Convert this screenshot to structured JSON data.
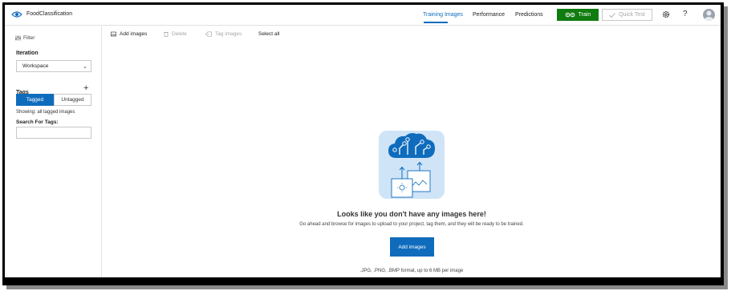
{
  "header": {
    "project_name": "FoodClassification",
    "tabs": [
      {
        "label": "Training Images",
        "active": true
      },
      {
        "label": "Performance",
        "active": false
      },
      {
        "label": "Predictions",
        "active": false
      }
    ],
    "train_label": "Train",
    "quick_test_label": "Quick Test",
    "help_label": "?",
    "accent_color": "#0f6cbd",
    "train_color": "#107c10",
    "icons": [
      "eye-logo-icon",
      "gear-icon",
      "help-icon",
      "avatar"
    ]
  },
  "sidebar": {
    "filter_label": "Filter",
    "iteration_label": "Iteration",
    "iteration_value": "Workspace",
    "tags_label": "Tags",
    "add_tag_symbol": "+",
    "tagged_label": "Tagged",
    "untagged_label": "Untagged",
    "showing_text": "Showing: all tagged images",
    "search_label": "Search For Tags:",
    "search_value": ""
  },
  "toolbar": {
    "add_images": "Add images",
    "delete": "Delete",
    "tag_images": "Tag images",
    "select_all": "Select all"
  },
  "empty_state": {
    "title": "Looks like you don't have any images here!",
    "description": "Go ahead and browse for images to upload to your project, tag them, and they will be ready to be trained.",
    "button_label": "Add images",
    "format_note": ".JPG, .PNG, .BMP format, up to 6 MB per image"
  }
}
